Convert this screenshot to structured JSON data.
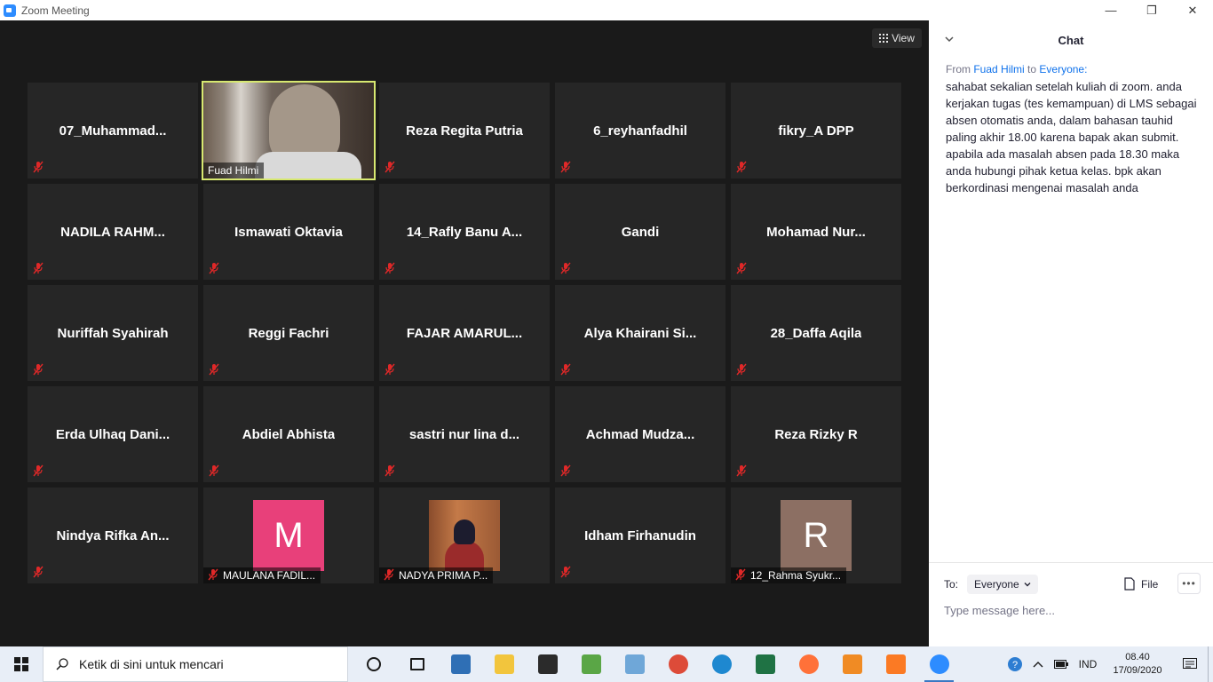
{
  "window": {
    "title": "Zoom Meeting",
    "controls": [
      "—",
      "❐",
      "✕"
    ]
  },
  "meeting": {
    "view_label": "View",
    "tiles": [
      {
        "name": "07_Muhammad...",
        "type": "name"
      },
      {
        "name": "Fuad Hilmi",
        "type": "video"
      },
      {
        "name": "Reza Regita Putria",
        "type": "name"
      },
      {
        "name": "6_reyhanfadhil",
        "type": "name"
      },
      {
        "name": "fikry_A DPP",
        "type": "name"
      },
      {
        "name": "NADILA  RAHM...",
        "type": "name"
      },
      {
        "name": "Ismawati Oktavia",
        "type": "name"
      },
      {
        "name": "14_Rafly Banu A...",
        "type": "name"
      },
      {
        "name": "Gandi",
        "type": "name"
      },
      {
        "name": "Mohamad  Nur...",
        "type": "name"
      },
      {
        "name": "Nuriffah Syahirah",
        "type": "name"
      },
      {
        "name": "Reggi Fachri",
        "type": "name"
      },
      {
        "name": "FAJAR AMARUL...",
        "type": "name"
      },
      {
        "name": "Alya  Khairani  Si...",
        "type": "name"
      },
      {
        "name": "28_Daffa Aqila",
        "type": "name"
      },
      {
        "name": "Erda  Ulhaq  Dani...",
        "type": "name"
      },
      {
        "name": "Abdiel Abhista",
        "type": "name"
      },
      {
        "name": "sastri nur lina d...",
        "type": "name"
      },
      {
        "name": "Achmad  Mudza...",
        "type": "name"
      },
      {
        "name": "Reza Rizky R",
        "type": "name"
      },
      {
        "name": "Nindya  Rifka  An...",
        "type": "name"
      },
      {
        "name": "MAULANA FADIL...",
        "type": "avatar",
        "initial": "M",
        "color": "#e8407a"
      },
      {
        "name": "NADYA PRIMA P...",
        "type": "photo"
      },
      {
        "name": "Idham Firhanudin",
        "type": "name"
      },
      {
        "name": "12_Rahma Syukr...",
        "type": "avatar",
        "initial": "R",
        "color": "#8c6f63"
      }
    ]
  },
  "chat": {
    "title": "Chat",
    "from_prefix": "From",
    "from_name": "Fuad Hilmi",
    "to_word": "to",
    "to_name": "Everyone:",
    "message": "sahabat sekalian setelah kuliah di zoom. anda kerjakan tugas (tes kemampuan) di LMS sebagai absen otomatis anda, dalam bahasan tauhid paling akhir 18.00 karena bapak akan submit. apabila ada masalah absen pada 18.30 maka anda hubungi pihak ketua kelas. bpk akan berkordinasi mengenai masalah anda",
    "to_label": "To:",
    "recipient": "Everyone",
    "file_label": "File",
    "input_placeholder": "Type message here..."
  },
  "taskbar": {
    "search_placeholder": "Ketik di sini untuk mencari",
    "language": "IND",
    "time": "08.40",
    "date": "17/09/2020",
    "apps": [
      {
        "name": "cortana-icon",
        "color": "#1a1a1a"
      },
      {
        "name": "task-view-icon",
        "color": "#1a1a1a"
      },
      {
        "name": "virtualbox-icon",
        "color": "#2f6fb5"
      },
      {
        "name": "file-explorer-icon",
        "color": "#f2c53d"
      },
      {
        "name": "store-icon",
        "color": "#2b2b2b"
      },
      {
        "name": "task-manager-icon",
        "color": "#5aa646"
      },
      {
        "name": "paint-icon",
        "color": "#6fa7d8"
      },
      {
        "name": "chrome-icon",
        "color": "#dd4b39"
      },
      {
        "name": "edge-icon",
        "color": "#1e88d0"
      },
      {
        "name": "excel-icon",
        "color": "#1f7244"
      },
      {
        "name": "firefox-icon",
        "color": "#ff7139"
      },
      {
        "name": "sublime-icon",
        "color": "#f08b24"
      },
      {
        "name": "xampp-icon",
        "color": "#fb7a24"
      },
      {
        "name": "zoom-icon",
        "color": "#2d8cff"
      }
    ]
  },
  "colors": {
    "active_speaker": "#d7e870",
    "mute_red": "#e02828",
    "link_blue": "#0e71eb"
  }
}
